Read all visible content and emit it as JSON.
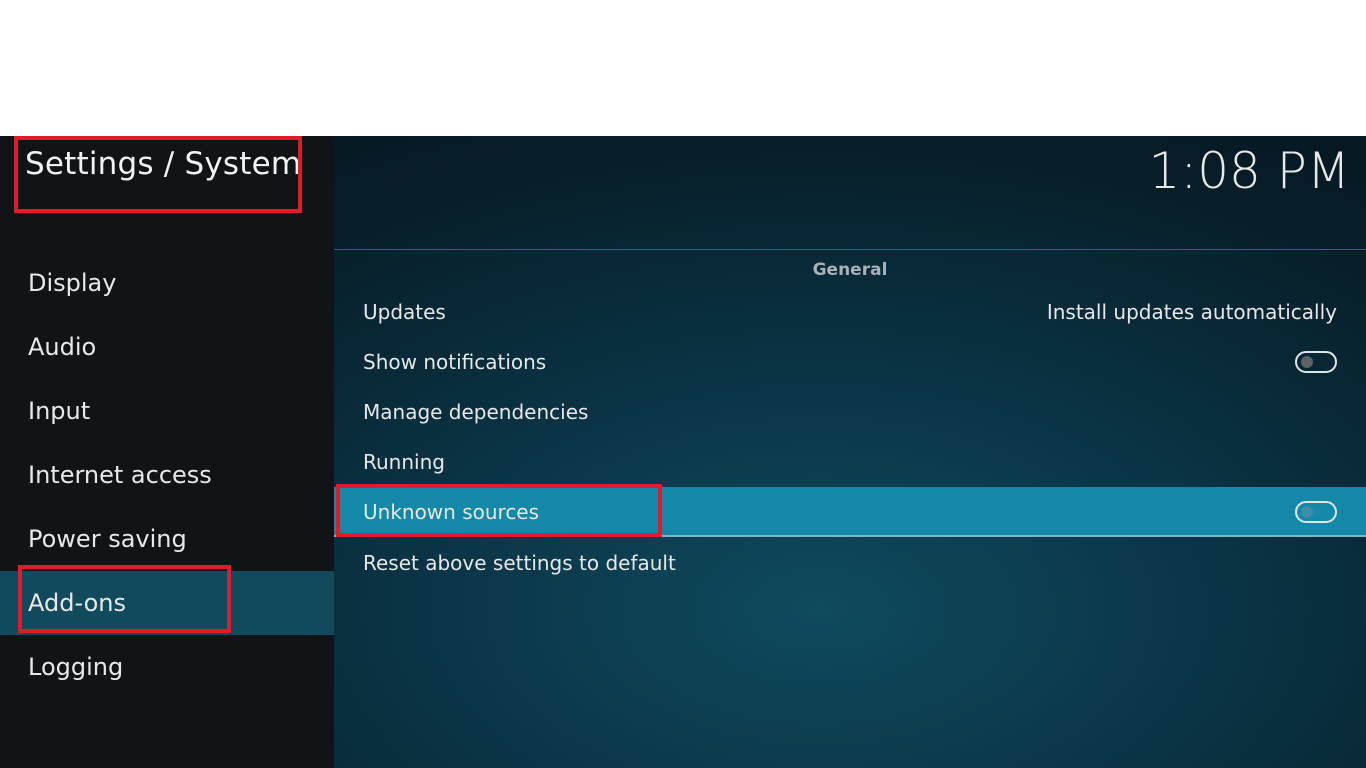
{
  "header": {
    "page_title": "Settings / System",
    "clock": "1:08 PM"
  },
  "sidebar": {
    "items": [
      {
        "label": "Display"
      },
      {
        "label": "Audio"
      },
      {
        "label": "Input"
      },
      {
        "label": "Internet access"
      },
      {
        "label": "Power saving"
      },
      {
        "label": "Add-ons",
        "active": true
      },
      {
        "label": "Logging"
      }
    ]
  },
  "main": {
    "section_label": "General",
    "settings": [
      {
        "label": "Updates",
        "value": "Install updates automatically"
      },
      {
        "label": "Show notifications",
        "toggle": false
      },
      {
        "label": "Manage dependencies"
      },
      {
        "label": "Running"
      },
      {
        "label": "Unknown sources",
        "toggle": false,
        "focused": true
      },
      {
        "label": "Reset above settings to default"
      }
    ]
  },
  "colors": {
    "highlight_box": "#e01b2a",
    "focused_row": "#1388a8",
    "active_nav": "#124a5d",
    "sidebar_bg": "#111417"
  }
}
